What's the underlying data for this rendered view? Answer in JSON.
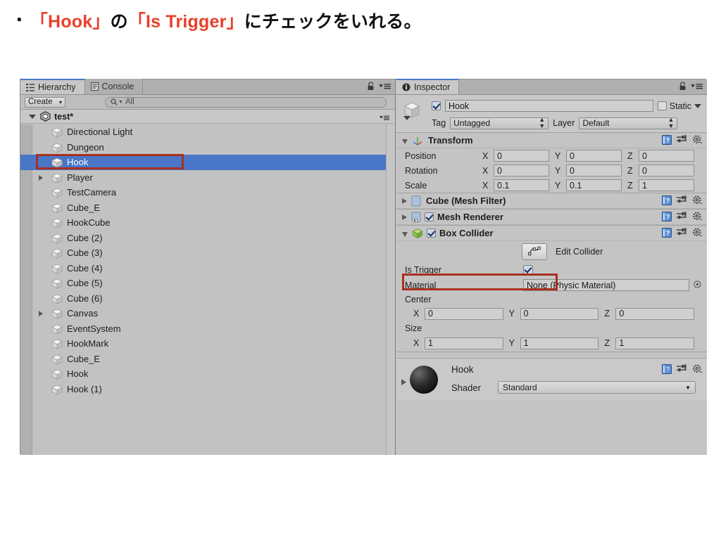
{
  "slide": {
    "bullet": "•",
    "title_parts": [
      {
        "text": "「Hook」",
        "accent": true
      },
      {
        "text": "の",
        "accent": false
      },
      {
        "text": "「Is Trigger」",
        "accent": true
      },
      {
        "text": "にチェックをいれる。",
        "accent": false
      }
    ],
    "accent_color": "#E8402A"
  },
  "hierarchy": {
    "tabs": [
      {
        "label": "Hierarchy",
        "icon": "hierarchy-icon",
        "active": true
      },
      {
        "label": "Console",
        "icon": "console-icon",
        "active": false
      }
    ],
    "lock_icon": "lock-icon",
    "menu_icon": "panel-menu-icon",
    "toolbar": {
      "create_label": "Create",
      "create_arrow": "▾",
      "search_placeholder": "All",
      "search_icon": "search-icon"
    },
    "scene": {
      "name": "test*",
      "expanded": true,
      "icon": "unity-scene-icon"
    },
    "items": [
      {
        "label": "Directional Light",
        "expandable": false,
        "selected": false
      },
      {
        "label": "Dungeon",
        "expandable": false,
        "selected": false
      },
      {
        "label": "Hook",
        "expandable": false,
        "selected": true
      },
      {
        "label": "Player",
        "expandable": true,
        "selected": false
      },
      {
        "label": "TestCamera",
        "expandable": false,
        "selected": false
      },
      {
        "label": "Cube_E",
        "expandable": false,
        "selected": false
      },
      {
        "label": "HookCube",
        "expandable": false,
        "selected": false
      },
      {
        "label": "Cube (2)",
        "expandable": false,
        "selected": false
      },
      {
        "label": "Cube (3)",
        "expandable": false,
        "selected": false
      },
      {
        "label": "Cube (4)",
        "expandable": false,
        "selected": false
      },
      {
        "label": "Cube (5)",
        "expandable": false,
        "selected": false
      },
      {
        "label": "Cube (6)",
        "expandable": false,
        "selected": false
      },
      {
        "label": "Canvas",
        "expandable": true,
        "selected": false
      },
      {
        "label": "EventSystem",
        "expandable": false,
        "selected": false
      },
      {
        "label": "HookMark",
        "expandable": false,
        "selected": false
      },
      {
        "label": "Cube_E",
        "expandable": false,
        "selected": false
      },
      {
        "label": "Hook",
        "expandable": false,
        "selected": false
      },
      {
        "label": "Hook (1)",
        "expandable": false,
        "selected": false
      }
    ],
    "selection_color": "#4A76C8",
    "highlight_color": "#A8301F"
  },
  "inspector": {
    "tab_label": "Inspector",
    "tab_icon": "info-icon",
    "lock_icon": "lock-icon",
    "menu_icon": "panel-menu-icon",
    "gameobject": {
      "enabled": true,
      "name": "Hook",
      "static_label": "Static",
      "static_checked": false,
      "tag_label": "Tag",
      "tag_value": "Untagged",
      "layer_label": "Layer",
      "layer_value": "Default"
    },
    "components": [
      {
        "name": "Transform",
        "icon": "transform-icon",
        "expanded": true,
        "has_enable_checkbox": false,
        "rows": [
          {
            "label": "Position",
            "x": "0",
            "y": "0",
            "z": "0"
          },
          {
            "label": "Rotation",
            "x": "0",
            "y": "0",
            "z": "0"
          },
          {
            "label": "Scale",
            "x": "0.1",
            "y": "0.1",
            "z": "1"
          }
        ]
      },
      {
        "name": "Cube (Mesh Filter)",
        "icon": "mesh-filter-icon",
        "expanded": false,
        "has_enable_checkbox": false
      },
      {
        "name": "Mesh Renderer",
        "icon": "mesh-renderer-icon",
        "expanded": false,
        "has_enable_checkbox": true,
        "enabled": true
      },
      {
        "name": "Box Collider",
        "icon": "box-collider-icon",
        "expanded": true,
        "has_enable_checkbox": true,
        "enabled": true,
        "edit_collider_label": "Edit Collider",
        "edit_collider_icon": "edit-collider-icon",
        "is_trigger_label": "Is Trigger",
        "is_trigger_checked": true,
        "material_label": "Material",
        "material_value": "None (Physic Material)",
        "material_picker_icon": "object-picker-icon",
        "center_label": "Center",
        "center": {
          "x": "0",
          "y": "0",
          "z": "0"
        },
        "size_label": "Size",
        "size": {
          "x": "1",
          "y": "1",
          "z": "1"
        }
      }
    ],
    "material_preview": {
      "name": "Hook",
      "shader_label": "Shader",
      "shader_value": "Standard",
      "sphere_icon": "material-sphere-icon"
    },
    "help_icon": "help-icon",
    "preset_icon": "preset-icon",
    "gear_icon": "gear-icon"
  }
}
